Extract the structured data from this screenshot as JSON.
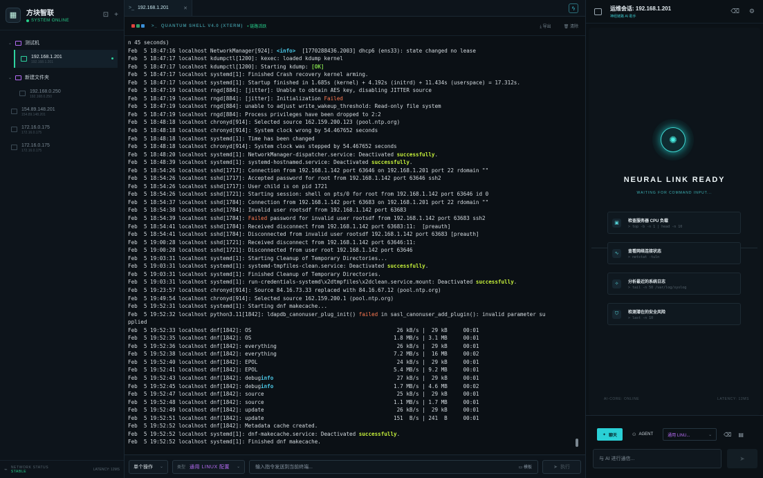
{
  "sidebar": {
    "brand_title": "方块智联",
    "brand_status": "SYSTEM ONLINE",
    "folders": [
      {
        "name": "测试机"
      },
      {
        "name": "新建文件夹"
      }
    ],
    "active_host": {
      "name": "192.168.1.201",
      "sub": "192.168.1.201"
    },
    "folder2_host": {
      "name": "192.168.0.250",
      "sub": "192.168.0.250"
    },
    "root_hosts": [
      {
        "name": "154.89.148.201",
        "sub": "154.89.148.201"
      },
      {
        "name": "172.16.0.175",
        "sub": "172.16.0.175"
      },
      {
        "name": "172.16.0.175",
        "sub": "172.16.0.175"
      }
    ],
    "footer_label": "NETWORK STATUS",
    "footer_state": "STABLE",
    "footer_latency": "LATENCY: 12MS"
  },
  "terminal": {
    "tab_label": "192.168.1.201",
    "shell_title": "QUANTUM SHELL V4.0 (XTERM)",
    "link_state": "链路活跃",
    "export_label": "导出",
    "clear_label": "清除",
    "log_lines": [
      "n 45 seconds)",
      "Feb  5 18:47:16 localhost NetworkManager[924]: <info>  [1770288436.2003] dhcp6 (ens33): state changed no lease",
      "Feb  5 18:47:17 localhost kdumpctl[1200]: kexec: loaded kdump kernel",
      "Feb  5 18:47:17 localhost kdumpctl[1200]: Starting kdump: [OK]",
      "Feb  5 18:47:17 localhost systemd[1]: Finished Crash recovery kernel arming.",
      "Feb  5 18:47:17 localhost systemd[1]: Startup finished in 1.685s (kernel) + 4.192s (initrd) + 11.434s (userspace) = 17.312s.",
      "Feb  5 18:47:19 localhost rngd[884]: [jitter]: Unable to obtain AES key, disabling JITTER source",
      "Feb  5 18:47:19 localhost rngd[884]: [jitter]: Initialization Failed",
      "Feb  5 18:47:19 localhost rngd[884]: unable to adjust write_wakeup_threshold: Read-only file system",
      "Feb  5 18:47:19 localhost rngd[884]: Process privileges have been dropped to 2:2",
      "Feb  5 18:48:18 localhost chronyd[914]: Selected source 162.159.200.123 (pool.ntp.org)",
      "Feb  5 18:48:18 localhost chronyd[914]: System clock wrong by 54.467652 seconds",
      "Feb  5 18:48:18 localhost systemd[1]: Time has been changed",
      "Feb  5 18:48:18 localhost chronyd[914]: System clock was stepped by 54.467652 seconds",
      "Feb  5 18:48:20 localhost systemd[1]: NetworkManager-dispatcher.service: Deactivated successfully.",
      "Feb  5 18:48:39 localhost systemd[1]: systemd-hostnamed.service: Deactivated successfully.",
      "Feb  5 18:54:26 localhost sshd[1717]: Connection from 192.168.1.142 port 63646 on 192.168.1.201 port 22 rdomain \"\"",
      "Feb  5 18:54:26 localhost sshd[1717]: Accepted password for root from 192.168.1.142 port 63646 ssh2",
      "Feb  5 18:54:26 localhost sshd[1717]: User child is on pid 1721",
      "Feb  5 18:54:26 localhost sshd[1721]: Starting session: shell on pts/0 for root from 192.168.1.142 port 63646 id 0",
      "Feb  5 18:54:37 localhost sshd[1784]: Connection from 192.168.1.142 port 63683 on 192.168.1.201 port 22 rdomain \"\"",
      "Feb  5 18:54:38 localhost sshd[1784]: Invalid user rootsdf from 192.168.1.142 port 63683",
      "Feb  5 18:54:39 localhost sshd[1784]: Failed password for invalid user rootsdf from 192.168.1.142 port 63683 ssh2",
      "Feb  5 18:54:41 localhost sshd[1784]: Received disconnect from 192.168.1.142 port 63683:11:  [preauth]",
      "Feb  5 18:54:41 localhost sshd[1784]: Disconnected from invalid user rootsdf 192.168.1.142 port 63683 [preauth]",
      "Feb  5 19:00:28 localhost sshd[1721]: Received disconnect from 192.168.1.142 port 63646:11:",
      "Feb  5 19:00:28 localhost sshd[1721]: Disconnected from user root 192.168.1.142 port 63646",
      "Feb  5 19:03:31 localhost systemd[1]: Starting Cleanup of Temporary Directories...",
      "Feb  5 19:03:31 localhost systemd[1]: systemd-tmpfiles-clean.service: Deactivated successfully.",
      "Feb  5 19:03:31 localhost systemd[1]: Finished Cleanup of Temporary Directories.",
      "Feb  5 19:03:31 localhost systemd[1]: run-credentials-systemd\\x2dtmpfiles\\x2dclean.service.mount: Deactivated successfully.",
      "Feb  5 19:23:57 localhost chronyd[914]: Source 84.16.73.33 replaced with 84.16.67.12 (pool.ntp.org)",
      "Feb  5 19:49:54 localhost chronyd[914]: Selected source 162.159.200.1 (pool.ntp.org)",
      "Feb  5 19:52:31 localhost systemd[1]: Starting dnf makecache...",
      "Feb  5 19:52:32 localhost python3.11[1842]: ldapdb_canonuser_plug_init() failed in sasl_canonuser_add_plugin(): invalid parameter su",
      "pplied",
      "Feb  5 19:52:33 localhost dnf[1842]: OS                                              26 kB/s |  29 kB     00:01",
      "Feb  5 19:52:35 localhost dnf[1842]: OS                                             1.8 MB/s | 3.1 MB     00:01",
      "Feb  5 19:52:36 localhost dnf[1842]: everything                                      26 kB/s |  29 kB     00:01",
      "Feb  5 19:52:38 localhost dnf[1842]: everything                                     7.2 MB/s |  16 MB     00:02",
      "Feb  5 19:52:40 localhost dnf[1842]: EPOL                                            24 kB/s |  29 kB     00:01",
      "Feb  5 19:52:41 localhost dnf[1842]: EPOL                                           5.4 MB/s | 9.2 MB     00:01",
      "Feb  5 19:52:43 localhost dnf[1842]: debuginfo                                       27 kB/s |  29 kB     00:01",
      "Feb  5 19:52:45 localhost dnf[1842]: debuginfo                                      1.7 MB/s | 4.6 MB     00:02",
      "Feb  5 19:52:47 localhost dnf[1842]: source                                          25 kB/s |  29 kB     00:01",
      "Feb  5 19:52:48 localhost dnf[1842]: source                                         1.1 MB/s | 1.7 MB     00:01",
      "Feb  5 19:52:49 localhost dnf[1842]: update                                          26 kB/s |  29 kB     00:01",
      "Feb  5 19:52:51 localhost dnf[1842]: update                                         151  B/s | 241  B     00:01",
      "Feb  5 19:52:52 localhost dnf[1842]: Metadata cache created.",
      "Feb  5 19:52:52 localhost systemd[1]: dnf-makecache.service: Deactivated successfully.",
      "Feb  5 19:52:52 localhost systemd[1]: Finished dnf makecache."
    ],
    "highlights": [
      {
        "text": "<info>",
        "cls": "hl-info"
      },
      {
        "text": "[OK]",
        "cls": "hl-ok"
      },
      {
        "text": "Failed",
        "cls": "hl-fail"
      },
      {
        "text": "failed",
        "cls": "hl-fail"
      },
      {
        "text": "successfully",
        "cls": "hl-succ"
      },
      {
        "text": "info",
        "cls": "hl-info"
      }
    ],
    "cmd": {
      "mode_label": "单个操作",
      "type_key": "类型",
      "type_value": "通用 LINUX 配置",
      "input_placeholder": "输入指令发送到当前终端...",
      "template_label": "模板",
      "exec_label": "执行"
    }
  },
  "ai": {
    "title": "运维会话: 192.168.1.201",
    "subtitle": "神经链路 AI 助手",
    "ready_title": "NEURAL LINK READY",
    "ready_sub": "WAITING FOR COMMAND INPUT...",
    "suggestions": [
      {
        "title": "检查服务器 CPU 负载",
        "cmd": "> top -b -n 1 | head -n 10"
      },
      {
        "title": "查看网络连接状态",
        "cmd": "> netstat -tuln"
      },
      {
        "title": "分析最近的系统日志",
        "cmd": "> tail -n 50 /var/log/syslog"
      },
      {
        "title": "检测潜在的安全风险",
        "cmd": "> last -n 10"
      }
    ],
    "status_left": "AI-CORE: ONLINE",
    "status_right": "LATENCY: 12MS",
    "mode_chat": "聊天",
    "mode_agent": "AGENT",
    "mode_select": "通用 LINU...",
    "input_placeholder": "与 AI 进行通信..."
  }
}
